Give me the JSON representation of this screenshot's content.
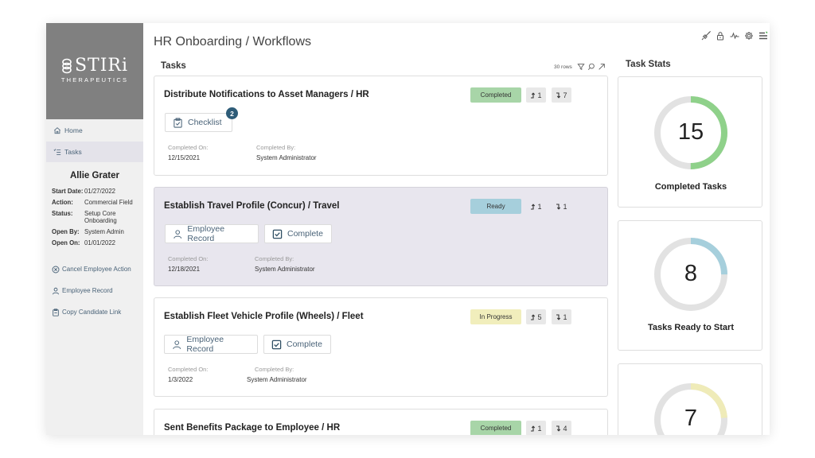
{
  "brand": {
    "name": "STIRi",
    "subtitle": "THERAPEUTICS"
  },
  "page": {
    "title": "HR Onboarding / Workflows"
  },
  "top_icons": [
    "rocket-icon",
    "lock-icon",
    "activity-icon",
    "gear-icon",
    "menu-icon"
  ],
  "sidebar": {
    "nav": [
      {
        "label": "Home",
        "icon": "home-icon",
        "active": false
      },
      {
        "label": "Tasks",
        "icon": "tasks-icon",
        "active": true
      }
    ],
    "employee": {
      "name": "Allie Grater",
      "fields": [
        {
          "key": "Start Date:",
          "value": "01/27/2022"
        },
        {
          "key": "Action:",
          "value": "Commercial Field"
        },
        {
          "key": "Status:",
          "value": "Setup Core Onboarding"
        },
        {
          "key": "Open By:",
          "value": "System Admin"
        },
        {
          "key": "Open On:",
          "value": "01/01/2022"
        }
      ]
    },
    "actions": [
      {
        "label": "Cancel Employee Action",
        "icon": "cancel-circle-icon"
      },
      {
        "label": "Employee Record",
        "icon": "user-icon"
      },
      {
        "label": "Copy Candidate Link",
        "icon": "clipboard-icon"
      }
    ]
  },
  "tasks": {
    "label": "Tasks",
    "row_count": "30 rows",
    "tools": [
      "filter-icon",
      "search-icon",
      "expand-icon"
    ],
    "items": [
      {
        "title": "Distribute Notifications to Asset Managers / HR",
        "status": "Completed",
        "up_count": "1",
        "down_count": "7",
        "buttons": [
          {
            "label": "Checklist",
            "icon": "checklist-icon",
            "badge": "2"
          }
        ],
        "completed_on_label": "Completed On:",
        "completed_on": "12/15/2021",
        "completed_by_label": "Completed By:",
        "completed_by": "System Administrator"
      },
      {
        "title": "Establish Travel Profile (Concur) / Travel",
        "status": "Ready",
        "up_count": "1",
        "down_count": "1",
        "buttons": [
          {
            "label": "Employee Record",
            "icon": "user-icon"
          },
          {
            "label": "Complete",
            "icon": "checkbox-icon"
          }
        ],
        "completed_on_label": "Completed On:",
        "completed_on": "12/18/2021",
        "completed_by_label": "Completed By:",
        "completed_by": "System Administrator"
      },
      {
        "title": "Establish Fleet Vehicle Profile (Wheels) / Fleet",
        "status": "In Progress",
        "up_count": "5",
        "down_count": "1",
        "buttons": [
          {
            "label": "Employee Record",
            "icon": "user-icon"
          },
          {
            "label": "Complete",
            "icon": "checkbox-icon"
          }
        ],
        "completed_on_label": "Completed On:",
        "completed_on": "1/3/2022",
        "completed_by_label": "Completed By:",
        "completed_by": "System Administrator"
      },
      {
        "title": "Sent Benefits Package to Employee / HR",
        "status": "Completed",
        "up_count": "1",
        "down_count": "4"
      }
    ]
  },
  "status_colors": {
    "Completed": "#a8d5a8",
    "Ready": "#a6cfdc",
    "In Progress": "#f1eebc"
  },
  "stats": {
    "label": "Task Stats",
    "total": 30,
    "cards": [
      {
        "value": "15",
        "label": "Completed Tasks",
        "fraction": 0.5,
        "color": "#8fd18a"
      },
      {
        "value": "8",
        "label": "Tasks Ready to Start",
        "fraction": 0.25,
        "color": "#a6cfdc"
      },
      {
        "value": "7",
        "label": "",
        "fraction": 0.24,
        "color": "#efebb8"
      }
    ]
  }
}
